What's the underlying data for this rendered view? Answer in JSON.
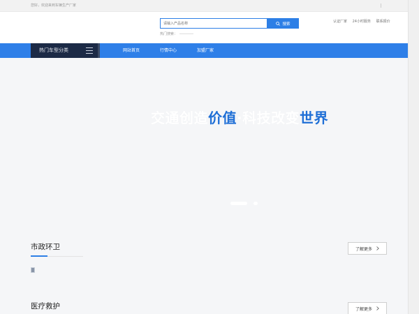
{
  "topbar": {
    "welcome": "您好，欢迎来到车辆生产厂家"
  },
  "header": {
    "search_placeholder": "请输入产品名称",
    "search_button": "搜索",
    "hot_label": "热门搜索：",
    "links": [
      "认证厂家",
      "24小时服务",
      "联系报价"
    ]
  },
  "nav": {
    "category": "热门车型分类",
    "items": [
      "网站首页",
      "行情中心",
      "加盟厂家"
    ]
  },
  "hero": {
    "slogan_part1": "交通创造",
    "slogan_part2": "价值",
    "slogan_part3": "·科技改变",
    "slogan_part4": "世界"
  },
  "sections": [
    {
      "title": "市政环卫",
      "more": "了解更多"
    },
    {
      "title": "医疗救护",
      "more": "了解更多"
    }
  ],
  "colors": {
    "accent": "#2e7fe8",
    "category_bg": "#1c2a46",
    "slogan_blue": "#1f6fd6"
  }
}
